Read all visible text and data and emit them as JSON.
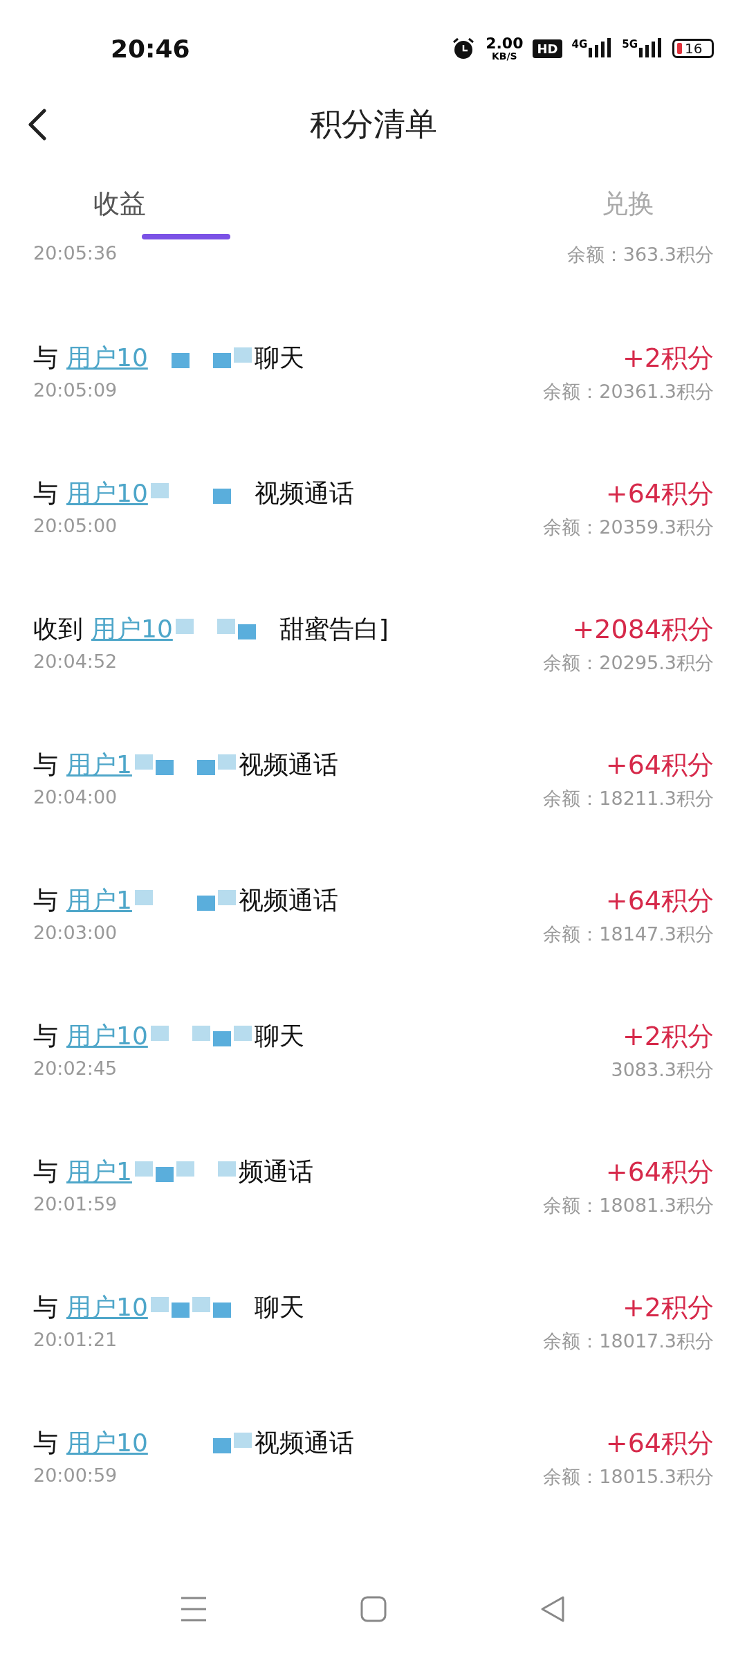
{
  "status_bar": {
    "time": "20:46",
    "net_speed": "2.00",
    "net_unit": "KB/S",
    "hd_label": "HD",
    "signal_1": "4G",
    "signal_2": "5G",
    "battery": "16"
  },
  "header": {
    "title": "积分清单"
  },
  "tabs": [
    {
      "label": "收益",
      "selected": true
    },
    {
      "label": "兑换",
      "selected": false
    }
  ],
  "partial_row": {
    "time": "20:05:36",
    "balance": "余额：363.3积分"
  },
  "records": [
    {
      "prefix": "与",
      "user": "用户10",
      "action": "聊天",
      "time": "20:05:09",
      "points": "+2积分",
      "balance": "余额：20361.3积分"
    },
    {
      "prefix": "与",
      "user": "用户10",
      "action": "视频通话",
      "time": "20:05:00",
      "points": "+64积分",
      "balance": "余额：20359.3积分"
    },
    {
      "prefix": "收到",
      "user": "用户10",
      "action": "甜蜜告白]",
      "time": "20:04:52",
      "points": "+2084积分",
      "balance": "余额：20295.3积分"
    },
    {
      "prefix": "与",
      "user": "用户1",
      "action": "视频通话",
      "time": "20:04:00",
      "points": "+64积分",
      "balance": "余额：18211.3积分"
    },
    {
      "prefix": "与",
      "user": "用户1",
      "action": "视频通话",
      "time": "20:03:00",
      "points": "+64积分",
      "balance": "余额：18147.3积分"
    },
    {
      "prefix": "与",
      "user": "用户10",
      "action": "聊天",
      "time": "20:02:45",
      "points": "+2积分",
      "balance": "3083.3积分"
    },
    {
      "prefix": "与",
      "user": "用户1",
      "action": "频通话",
      "time": "20:01:59",
      "points": "+64积分",
      "balance": "余额：18081.3积分"
    },
    {
      "prefix": "与",
      "user": "用户10",
      "action": "聊天",
      "time": "20:01:21",
      "points": "+2积分",
      "balance": "余额：18017.3积分"
    },
    {
      "prefix": "与",
      "user": "用户10",
      "action": "视频通话",
      "time": "20:00:59",
      "points": "+64积分",
      "balance": "余额：18015.3积分"
    }
  ]
}
